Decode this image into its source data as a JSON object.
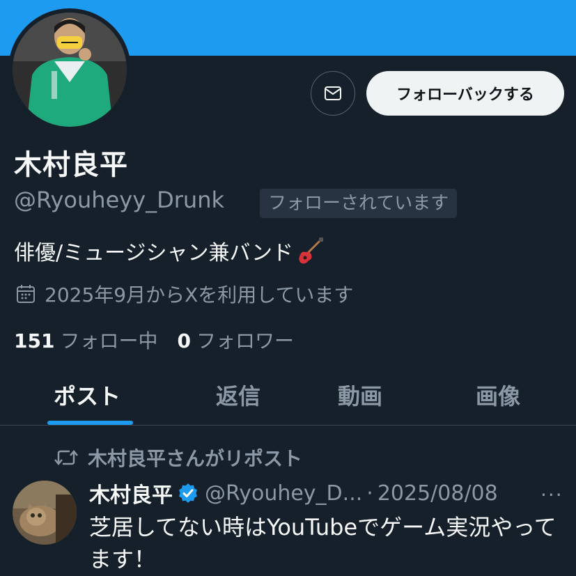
{
  "profile": {
    "display_name": "木村良平",
    "handle": "@Ryouheyy_Drunk",
    "follows_you": "フォローされています",
    "bio": "俳優/ミュージシャン兼バンド",
    "bio_emoji_icon": "guitar-icon",
    "joined": "2025年9月からXを利用しています",
    "following_count": "151",
    "following_label": "フォロー中",
    "followers_count": "0",
    "followers_label": "フォロワー",
    "follow_back_label": "フォローバックする",
    "message_icon": "envelope-icon",
    "banner_color": "#1d9bf0"
  },
  "tabs": [
    {
      "label": "ポスト",
      "active": true
    },
    {
      "label": "返信",
      "active": false
    },
    {
      "label": "動画",
      "active": false
    },
    {
      "label": "画像",
      "active": false
    }
  ],
  "post": {
    "repost_label": "木村良平さんがリポスト",
    "author_name": "木村良平",
    "author_handle": "@Ryouhey_D...",
    "separator": "·",
    "date": "2025/08/08",
    "more_label": "···",
    "text": "芝居してない時はYouTubeでゲーム実況やってます！",
    "verified": true
  },
  "colors": {
    "background": "#15202b",
    "accent": "#1d9bf0",
    "muted_text": "#8b98a5"
  }
}
